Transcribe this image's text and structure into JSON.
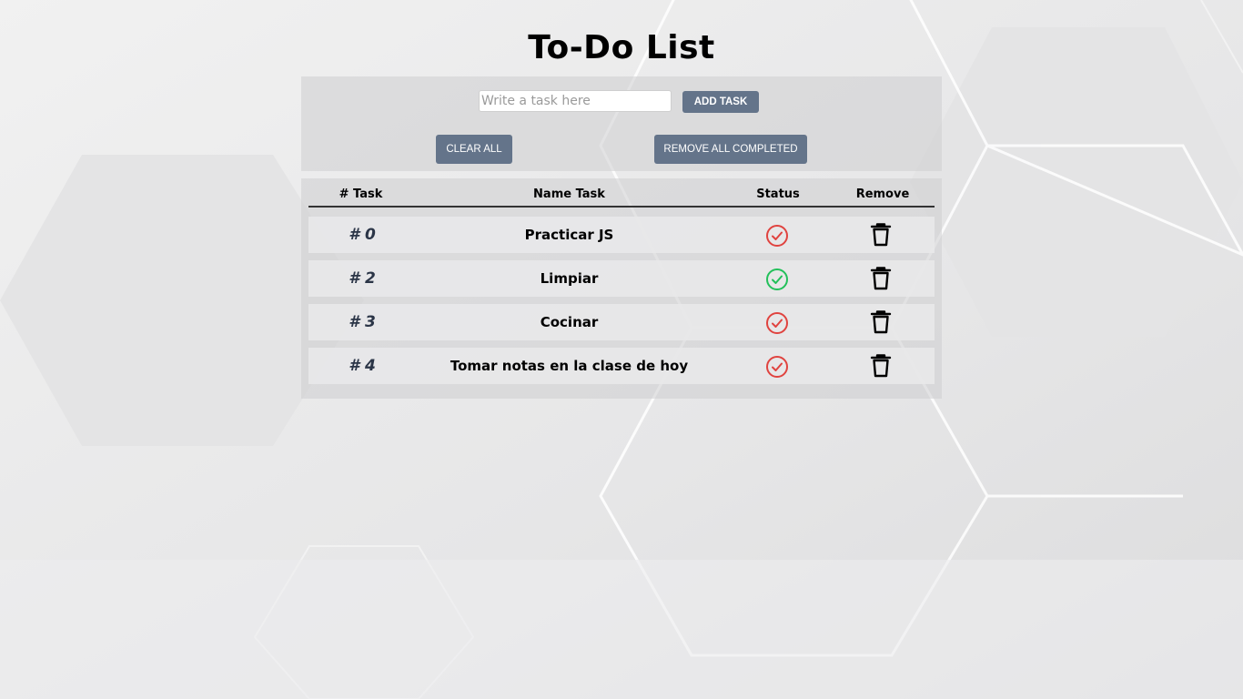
{
  "page": {
    "title": "To-Do List"
  },
  "controls": {
    "input_placeholder": "Write a task here",
    "input_value": "",
    "add_task_label": "ADD TASK",
    "clear_all_label": "CLEAR ALL",
    "remove_completed_label": "REMOVE ALL COMPLETED"
  },
  "table": {
    "headers": {
      "number": "# Task",
      "name": "Name Task",
      "status": "Status",
      "remove": "Remove"
    },
    "rows": [
      {
        "number": "# 0",
        "name": "Practicar JS",
        "completed": false,
        "status_icon": "check-circle-icon",
        "remove_icon": "trash-icon"
      },
      {
        "number": "# 2",
        "name": "Limpiar",
        "completed": true,
        "status_icon": "check-circle-icon",
        "remove_icon": "trash-icon"
      },
      {
        "number": "# 3",
        "name": "Cocinar",
        "completed": false,
        "status_icon": "check-circle-icon",
        "remove_icon": "trash-icon"
      },
      {
        "number": "# 4",
        "name": "Tomar notas en la clase de hoy",
        "completed": false,
        "status_icon": "check-circle-icon",
        "remove_icon": "trash-icon"
      }
    ]
  },
  "colors": {
    "button": "#64748a",
    "status_pending": "#e0433f",
    "status_completed": "#22c05a",
    "task_number": "#2b3547"
  }
}
